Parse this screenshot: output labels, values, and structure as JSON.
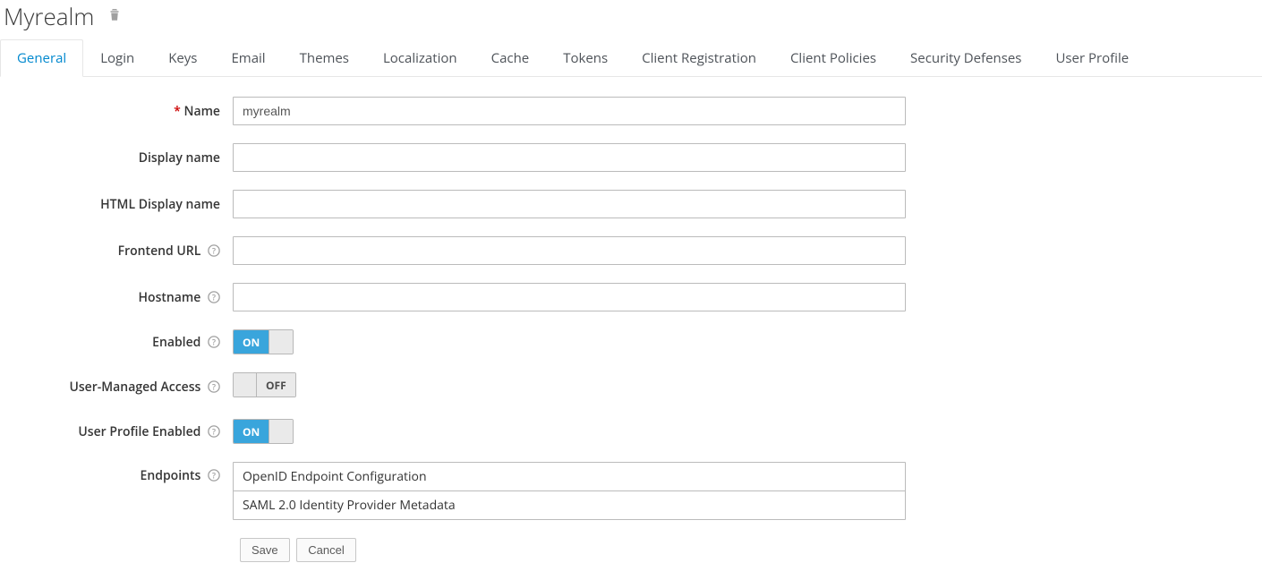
{
  "header": {
    "title": "Myrealm"
  },
  "tabs": {
    "items": [
      {
        "label": "General",
        "active": true
      },
      {
        "label": "Login"
      },
      {
        "label": "Keys"
      },
      {
        "label": "Email"
      },
      {
        "label": "Themes"
      },
      {
        "label": "Localization"
      },
      {
        "label": "Cache"
      },
      {
        "label": "Tokens"
      },
      {
        "label": "Client Registration"
      },
      {
        "label": "Client Policies"
      },
      {
        "label": "Security Defenses"
      },
      {
        "label": "User Profile"
      }
    ]
  },
  "form": {
    "name": {
      "label": "Name",
      "required": true,
      "value": "myrealm"
    },
    "display_name": {
      "label": "Display name",
      "value": ""
    },
    "html_display_name": {
      "label": "HTML Display name",
      "value": ""
    },
    "frontend_url": {
      "label": "Frontend URL",
      "value": "",
      "help": true
    },
    "hostname": {
      "label": "Hostname",
      "value": "",
      "help": true
    },
    "enabled": {
      "label": "Enabled",
      "value": true,
      "help": true,
      "on_text": "ON",
      "off_text": "OFF"
    },
    "uma": {
      "label": "User-Managed Access",
      "value": false,
      "help": true,
      "on_text": "ON",
      "off_text": "OFF"
    },
    "user_profile_enabled": {
      "label": "User Profile Enabled",
      "value": true,
      "help": true,
      "on_text": "ON",
      "off_text": "OFF"
    },
    "endpoints": {
      "label": "Endpoints",
      "help": true,
      "items": [
        "OpenID Endpoint Configuration",
        "SAML 2.0 Identity Provider Metadata"
      ]
    }
  },
  "actions": {
    "save": "Save",
    "cancel": "Cancel"
  }
}
